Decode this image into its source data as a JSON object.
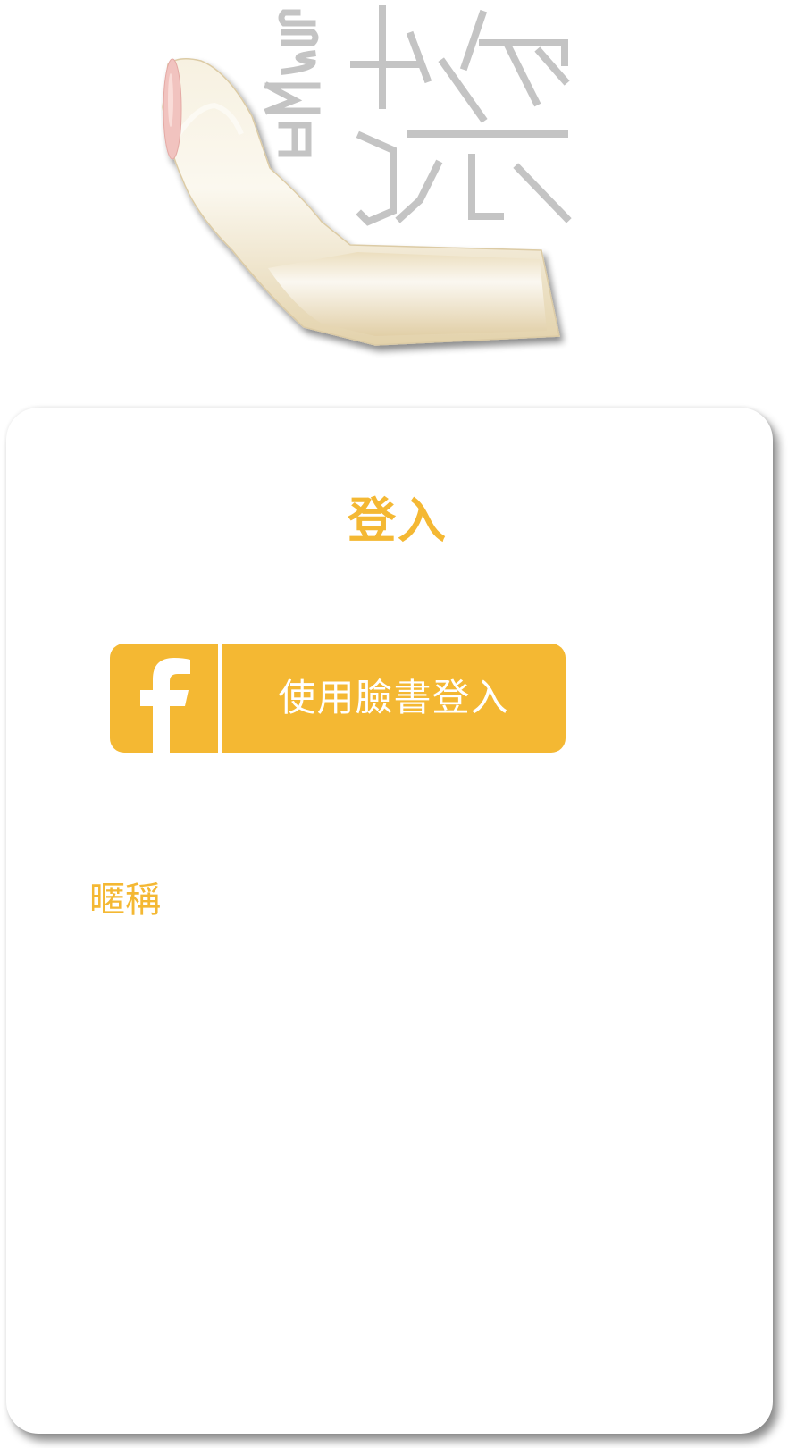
{
  "brand": {
    "logo_name": "hand-logo",
    "logo_text": "whose 控"
  },
  "login": {
    "title": "登入",
    "facebook_button_label": "使用臉書登入",
    "nickname_label": "暱稱"
  },
  "colors": {
    "accent": "#F4B833",
    "logo_text": "#C4C4C4",
    "hand": "#EDE0C2",
    "fingernail": "#F1C3BF",
    "card": "#FFFFFF"
  },
  "icons": [
    "hand-logo",
    "facebook-icon"
  ]
}
